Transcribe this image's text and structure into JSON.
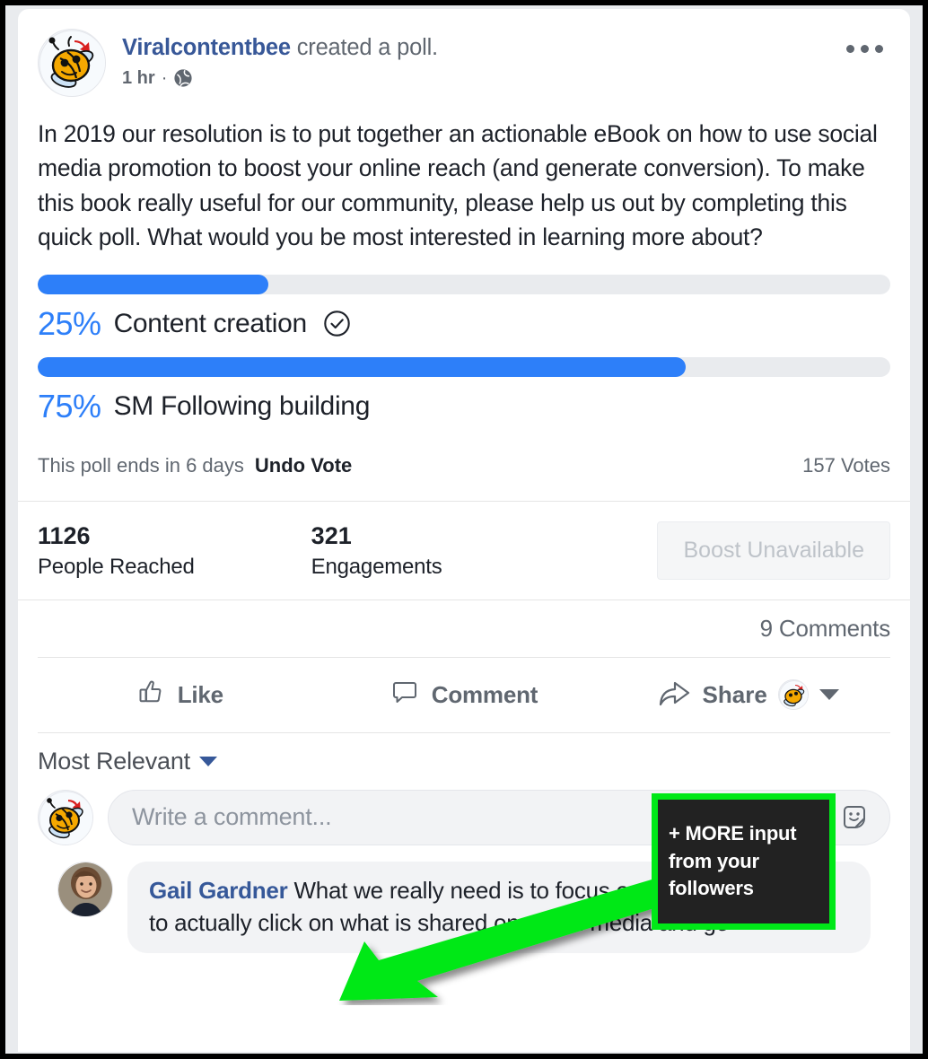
{
  "post": {
    "author": "Viralcontentbee",
    "action_text": " created a poll.",
    "timestamp": "1 hr",
    "separator": "·",
    "privacy_icon": "globe-icon",
    "menu_icon": "ellipsis-icon",
    "body": "In 2019 our resolution is to put together an actionable eBook on how to use social media promotion to boost your online reach (and generate conversion). To make this book really useful for our community, please help us out by completing this quick poll. What would you be most interested in learning more about?"
  },
  "poll": {
    "options": [
      {
        "percent": "25%",
        "label": "Content creation",
        "value": 25,
        "voted": true
      },
      {
        "percent": "75%",
        "label": "SM Following building",
        "value": 75,
        "voted": false
      }
    ],
    "ends_text": "This poll ends in 6 days",
    "undo_label": "Undo Vote",
    "votes_text": "157 Votes",
    "bar_color": "#2d7ff9",
    "track_color": "#e9ebee"
  },
  "stats": {
    "reached_value": "1126",
    "reached_label": "People Reached",
    "engagements_value": "321",
    "engagements_label": "Engagements",
    "boost_label": "Boost Unavailable"
  },
  "comments_meta": {
    "count_label": "9 Comments",
    "sort_label": "Most Relevant"
  },
  "actions": {
    "like_label": "Like",
    "comment_label": "Comment",
    "share_label": "Share"
  },
  "composer": {
    "placeholder": "Write a comment...",
    "icons": [
      "emoji-icon",
      "camera-icon",
      "gif-icon",
      "sticker-icon"
    ]
  },
  "comment": {
    "author": "Gail Gardner",
    "text": " What we really need is to focus on how to get people to actually click on what is shared on social media and go"
  },
  "annotation": {
    "text": "+ MORE input from your followers",
    "border_color": "#00e818",
    "background_color": "#222222",
    "arrow_color": "#00e818"
  }
}
